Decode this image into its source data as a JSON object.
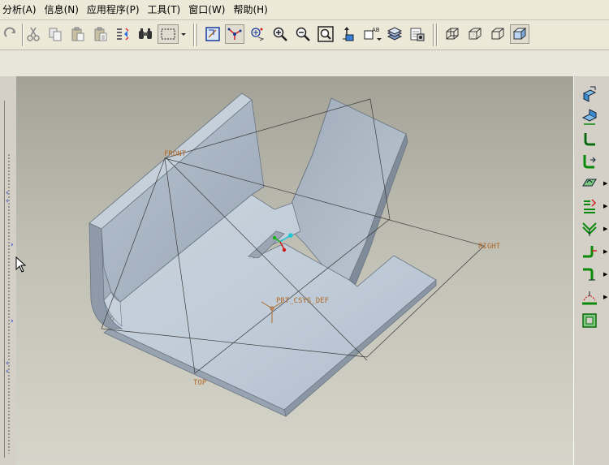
{
  "menubar": {
    "items": [
      {
        "label": "分析(A)",
        "name": "menu-analysis"
      },
      {
        "label": "信息(N)",
        "name": "menu-info"
      },
      {
        "label": "应用程序(P)",
        "name": "menu-applications"
      },
      {
        "label": "工具(T)",
        "name": "menu-tools"
      },
      {
        "label": "窗口(W)",
        "name": "menu-window"
      },
      {
        "label": "帮助(H)",
        "name": "menu-help"
      }
    ]
  },
  "toolbar": {
    "groups": [
      [
        "redo-icon",
        "cut-icon",
        "copy-icon",
        "paste-icon",
        "paste-special-icon",
        "regenerate-icon",
        "find-icon",
        "box-select-icon",
        "dropdown-arrow-icon"
      ],
      [
        "datum-plane-icon",
        "datum-axis-icon",
        "datum-point-icon",
        "zoom-in-icon",
        "zoom-out-icon",
        "refit-icon",
        "reorient-icon",
        "annotation-display-icon",
        "layers-icon",
        "saved-views-icon"
      ],
      [
        "wireframe-icon",
        "hidden-line-icon",
        "no-hidden-icon",
        "shading-icon"
      ]
    ],
    "active": [
      "datum-axis-icon",
      "shading-icon",
      "box-select-icon"
    ]
  },
  "viewport": {
    "datum_labels": {
      "front": "FRONT",
      "right": "RIGHT",
      "top": "TOP",
      "csys": "PRT_CSYS_DEF"
    },
    "model_color": "#b9c6d3",
    "datum_color": "#b06a28"
  },
  "right_toolbar": {
    "items": [
      {
        "icon": "flat-wall-icon",
        "more": false
      },
      {
        "icon": "unattached-wall-icon",
        "more": false
      },
      {
        "icon": "flange-wall-icon",
        "more": false
      },
      {
        "icon": "extend-wall-icon",
        "more": false
      },
      {
        "icon": "form-icon",
        "more": true
      },
      {
        "icon": "rip-icon",
        "more": true
      },
      {
        "icon": "merge-walls-icon",
        "more": true
      },
      {
        "icon": "bend-icon",
        "more": true
      },
      {
        "icon": "edge-bend-icon",
        "more": true
      },
      {
        "icon": "unbend-icon",
        "more": true
      },
      {
        "icon": "flat-pattern-icon",
        "more": false
      }
    ]
  }
}
